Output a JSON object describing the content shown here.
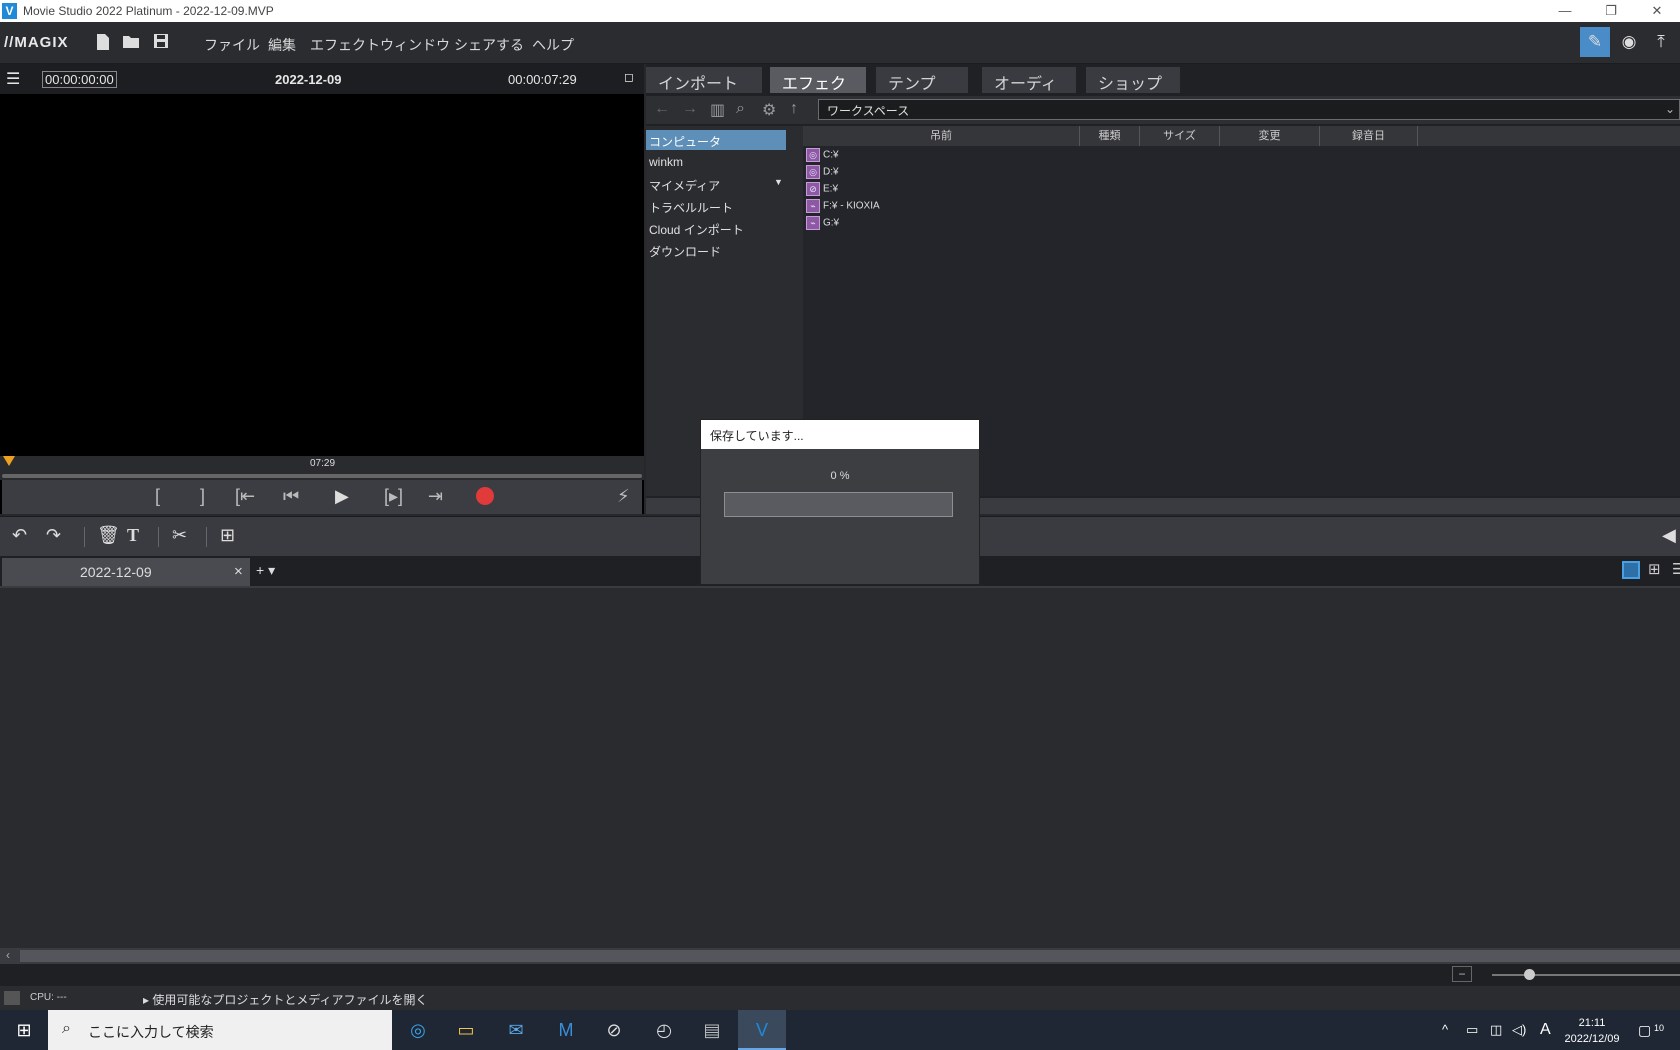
{
  "titlebar": {
    "app_icon": "V",
    "title": "Movie Studio 2022 Platinum - 2022-12-09.MVP",
    "minimize": "—",
    "restore": "❐",
    "close": "✕"
  },
  "menubar": {
    "logo": "//MAGIX",
    "items": [
      "ファイル",
      "編集",
      "エフェクト",
      "ウィンドウ",
      "シェアする",
      "ヘルプ"
    ]
  },
  "preview": {
    "timecode_left": "00:00:00:00",
    "title": "2022-12-09",
    "timecode_right": "00:00:07:29",
    "scrub_label": "07:29"
  },
  "tabs": [
    "インポート",
    "エフェクト",
    "テンプレ...",
    "オーディオ",
    "ショップ"
  ],
  "toolbar": {
    "path": "ワークスペース"
  },
  "tree": [
    "コンピュータ",
    "winkm",
    "マイメディア",
    "トラベルルート",
    "Cloud インポート",
    "ダウンロード"
  ],
  "columns": [
    "吊前",
    "種類",
    "サイズ",
    "変更",
    "録音日"
  ],
  "drives": [
    "C:¥",
    "D:¥",
    "E:¥",
    "F:¥ - KIOXIA",
    "G:¥"
  ],
  "timeline": {
    "tab_label": "2022-12-09",
    "tab_close": "×",
    "add_label": "+ ▾"
  },
  "status": {
    "cpu": "CPU: ---",
    "hint": "使用可能なプロジェクトとメディアファイルを開く"
  },
  "dialog": {
    "title": "保存しています...",
    "percent_text": "0 %",
    "progress": 0.0
  },
  "taskbar": {
    "search_placeholder": "ここに入力して検索",
    "time": "21:11",
    "date": "2022/12/09",
    "ime": "A",
    "notif_count": "10"
  },
  "colors": {
    "accent": "#5e8fb8",
    "record": "#e03a3a",
    "marker": "#f0a020"
  }
}
